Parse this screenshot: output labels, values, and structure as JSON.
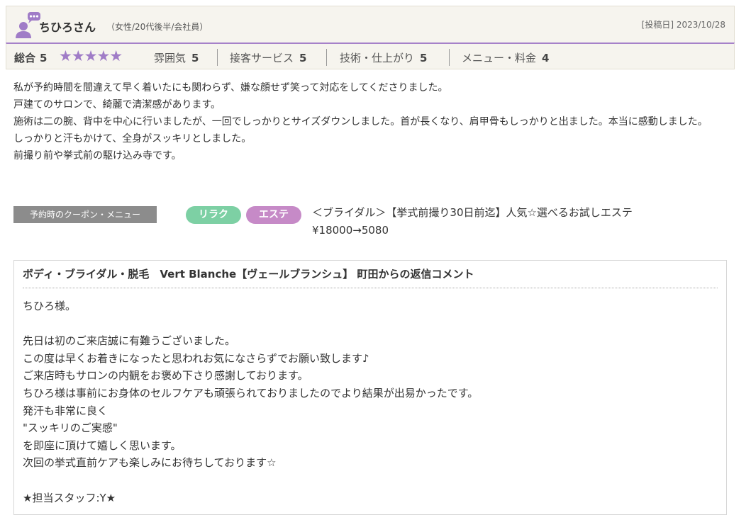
{
  "reviewer": {
    "name": "ちひろさん",
    "profile": "（女性/20代後半/会社員）",
    "post_date": "[投稿日] 2023/10/28",
    "avatar_icon": "user-chat-icon",
    "avatar_color": "#a07cc7"
  },
  "ratings": {
    "total_label": "総合",
    "total_value": "5",
    "stars": "★★★★★",
    "star_count": 5,
    "star_color": "#a07cc7",
    "items": [
      {
        "label": "雰囲気",
        "value": "5"
      },
      {
        "label": "接客サービス",
        "value": "5"
      },
      {
        "label": "技術・仕上がり",
        "value": "5"
      },
      {
        "label": "メニュー・料金",
        "value": "4"
      }
    ]
  },
  "review_text": [
    "私が予約時間を間違えて早く着いたにも関わらず、嫌な顔せず笑って対応をしてくださりました。",
    "戸建てのサロンで、綺麗で清潔感があります。",
    "施術は二の腕、背中を中心に行いましたが、一回でしっかりとサイズダウンしました。首が長くなり、肩甲骨もしっかりと出ました。本当に感動しました。",
    "しっかりと汗もかけて、全身がスッキリとしました。",
    "前撮り前や挙式前の駆け込み寺です。"
  ],
  "coupon": {
    "label": "予約時のクーポン・メニュー",
    "tags": [
      {
        "label": "リラク",
        "color": "#7dd0a4"
      },
      {
        "label": "エステ",
        "color": "#c68ac7"
      }
    ],
    "title": "＜ブライダル＞【挙式前撮り30日前迄】人気☆選べるお試しエステ",
    "price": "¥18000→5080"
  },
  "reply": {
    "title": "ボディ・ブライダル・脱毛　Vert Blanche【ヴェールブランシュ】 町田からの返信コメント",
    "lines": [
      "ちひろ様。",
      "",
      "先日は初のご来店誠に有難うございました。",
      "この度は早くお着きになったと思われお気になさらずでお願い致します♪",
      "ご来店時もサロンの内観をお褒め下さり感謝しております。",
      "ちひろ様は事前にお身体のセルフケアも頑張られておりましたのでより結果が出易かったです。",
      "発汗も非常に良く",
      "\"スッキリのご実感\"",
      "を即座に頂けて嬉しく思います。",
      "次回の挙式直前ケアも楽しみにお待ちしております☆",
      "",
      "★担当スタッフ:Y★"
    ]
  }
}
